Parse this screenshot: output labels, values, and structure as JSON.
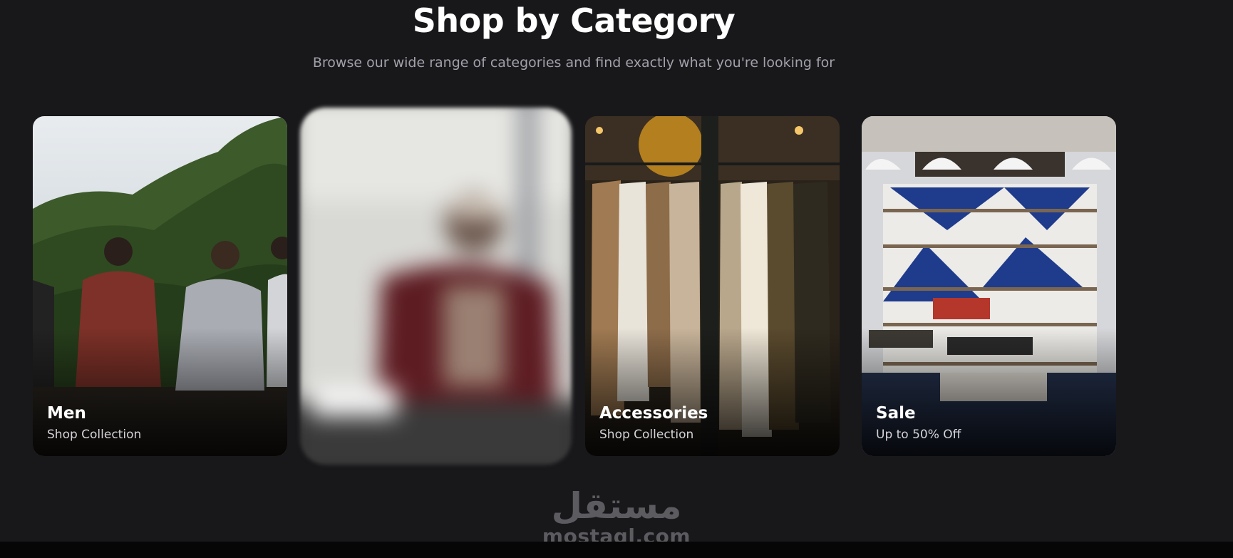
{
  "section": {
    "title": "Shop by Category",
    "subtitle": "Browse our wide range of categories and find exactly what you're looking for"
  },
  "categories": [
    {
      "title": "Men",
      "subtitle": "Shop Collection",
      "image": "friends-sitting-on-hill"
    },
    {
      "title": "",
      "subtitle": "",
      "image": "woman-in-burgundy-coat-blurred"
    },
    {
      "title": "Accessories",
      "subtitle": "Shop Collection",
      "image": "coats-on-rack"
    },
    {
      "title": "Sale",
      "subtitle": "Up to 50% Off",
      "image": "store-interior-shelves"
    }
  ],
  "watermark": {
    "logo": "مستقل",
    "text": "mostaql.com"
  },
  "colors": {
    "background": "#18181b",
    "title": "#ffffff",
    "subtitle": "#a1a1aa",
    "watermark": "#5b5b60"
  }
}
